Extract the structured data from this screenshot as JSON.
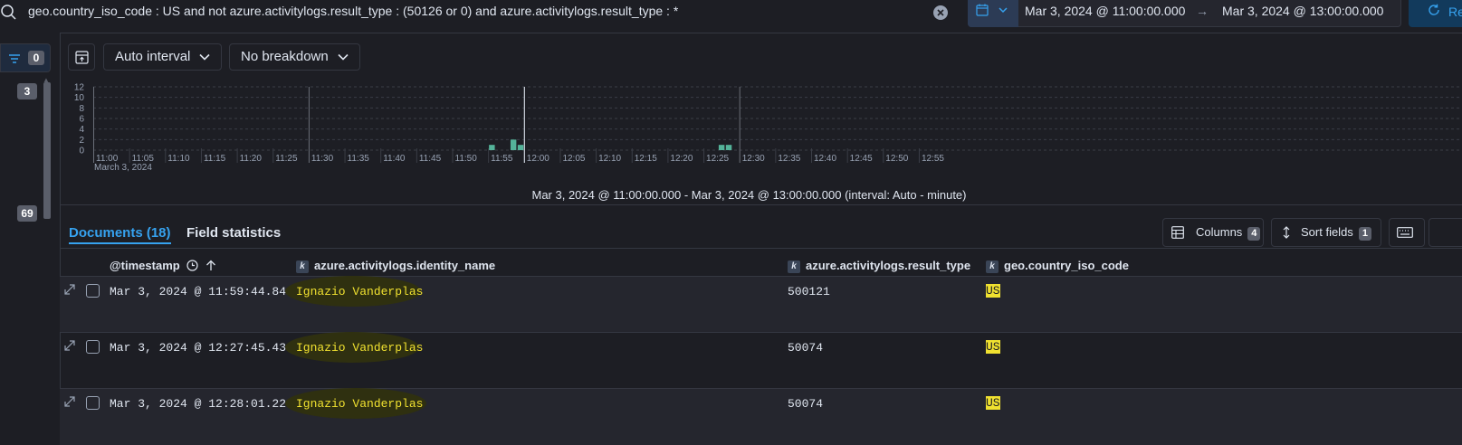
{
  "query": {
    "text": "geo.country_iso_code : US and not azure.activitylogs.result_type : (50126 or 0) and azure.activitylogs.result_type : *"
  },
  "date_range": {
    "start": "Mar 3, 2024 @ 11:00:00.000",
    "arrow": "→",
    "end": "Mar 3, 2024 @ 13:00:00.000",
    "refresh_label": "Re"
  },
  "left_rail": {
    "filter_count": "0",
    "badge_top": "3",
    "badge_bottom": "69"
  },
  "histogram_toolbar": {
    "interval": "Auto interval",
    "breakdown": "No breakdown"
  },
  "chart_data": {
    "type": "bar",
    "y_ticks": [
      "0",
      "2",
      "4",
      "6",
      "8",
      "10",
      "12"
    ],
    "ylim": [
      0,
      12
    ],
    "x_ticks": [
      "11:00",
      "11:05",
      "11:10",
      "11:15",
      "11:20",
      "11:25",
      "11:30",
      "11:35",
      "11:40",
      "11:45",
      "11:50",
      "11:55",
      "12:00",
      "12:05",
      "12:10",
      "12:15",
      "12:20",
      "12:25",
      "12:30",
      "12:35",
      "12:40",
      "12:45",
      "12:50",
      "12:55"
    ],
    "date_label": "March 3, 2024",
    "bars": [
      {
        "minute": 55,
        "value": 1
      },
      {
        "minute": 58,
        "value": 2
      },
      {
        "minute": 59,
        "value": 1
      },
      {
        "minute": 87,
        "value": 1
      },
      {
        "minute": 88,
        "value": 1
      }
    ],
    "bar_color": "#54b399",
    "grid": true,
    "interval_text": "Mar 3, 2024 @ 11:00:00.000 - Mar 3, 2024 @ 13:00:00.000 (interval: Auto - minute)"
  },
  "tabs": {
    "documents": "Documents (18)",
    "field_statistics": "Field statistics"
  },
  "table_tools": {
    "columns_label": "Columns",
    "columns_count": "4",
    "sort_label": "Sort fields",
    "sort_count": "1"
  },
  "columns": {
    "timestamp": "@timestamp",
    "identity_name": "azure.activitylogs.identity_name",
    "result_type": "azure.activitylogs.result_type",
    "country": "geo.country_iso_code",
    "field_type": "k"
  },
  "rows": [
    {
      "timestamp": "Mar 3, 2024 @ 11:59:44.841",
      "identity_name": "Ignazio Vanderplas",
      "result_type": "500121",
      "country": "US"
    },
    {
      "timestamp": "Mar 3, 2024 @ 12:27:45.438",
      "identity_name": "Ignazio Vanderplas",
      "result_type": "50074",
      "country": "US"
    },
    {
      "timestamp": "Mar 3, 2024 @ 12:28:01.226",
      "identity_name": "Ignazio Vanderplas",
      "result_type": "50074",
      "country": "US"
    }
  ],
  "colors": {
    "accent": "#36a2ef",
    "highlight": "#f0e130",
    "background": "#1d1e24"
  }
}
